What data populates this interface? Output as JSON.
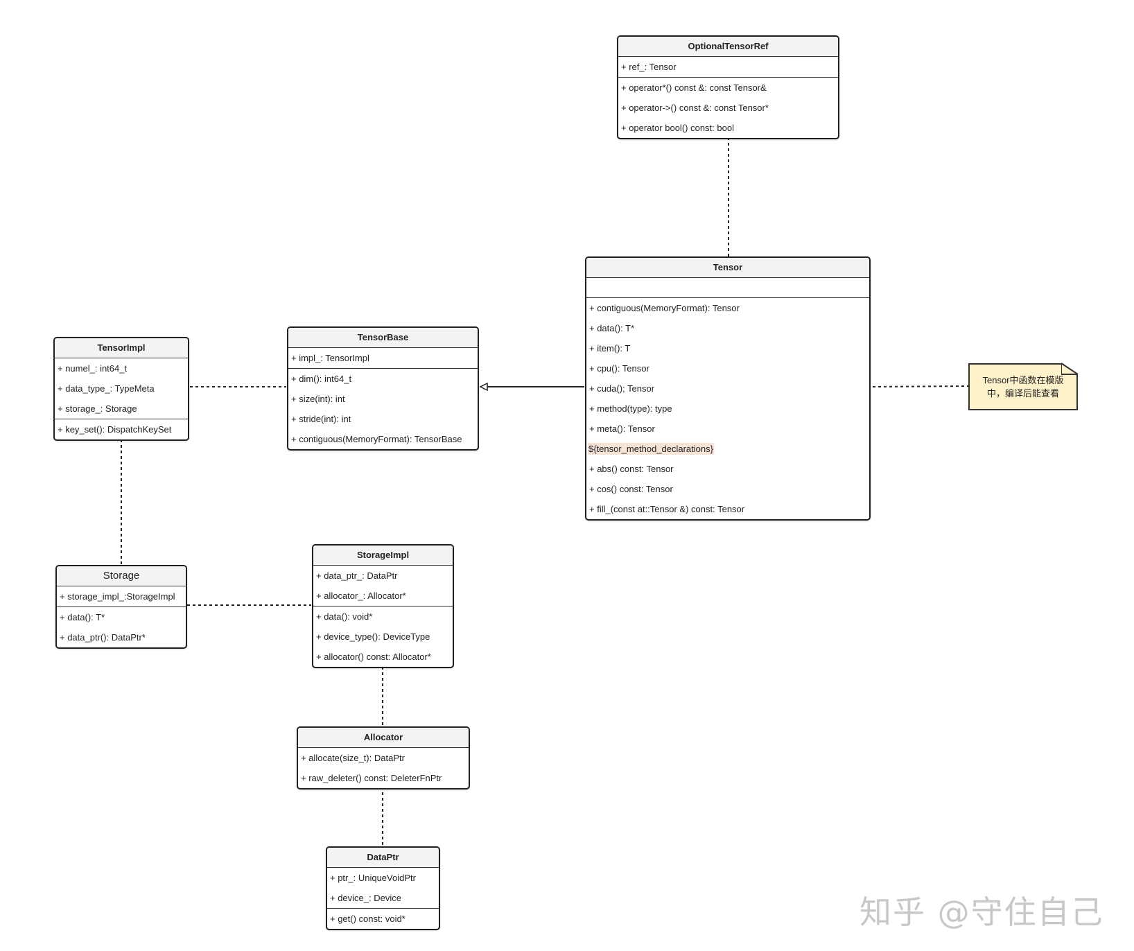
{
  "classes": {
    "optional_tensor_ref": {
      "name": "OptionalTensorRef",
      "attributes": [
        "+ ref_: Tensor"
      ],
      "methods": [
        "+ operator*() const &: const Tensor&",
        "+ operator->() const &: const Tensor*",
        "+ operator bool() const: bool"
      ]
    },
    "tensor": {
      "name": "Tensor",
      "methods_before": [
        "+ contiguous(MemoryFormat): Tensor",
        "+ data(): T*",
        "+ item(): T",
        "+ cpu(): Tensor",
        "+ cuda(); Tensor",
        "+ method(type): type",
        "+ meta(): Tensor"
      ],
      "template_placeholder": "${tensor_method_declarations}",
      "methods_after": [
        "+ abs() const: Tensor",
        "+ cos() const:  Tensor",
        "+ fill_(const at::Tensor &) const: Tensor"
      ]
    },
    "tensor_base": {
      "name": "TensorBase",
      "attributes": [
        "+ impl_: TensorImpl"
      ],
      "methods": [
        "+ dim(): int64_t",
        "+ size(int): int",
        "+ stride(int): int",
        "+ contiguous(MemoryFormat): TensorBase"
      ]
    },
    "tensor_impl": {
      "name": "TensorImpl",
      "attributes": [
        "+ numel_: int64_t",
        "+ data_type_: TypeMeta",
        "+ storage_: Storage"
      ],
      "methods": [
        "+ key_set(): DispatchKeySet"
      ]
    },
    "storage": {
      "name": "Storage",
      "attributes": [
        "+ storage_impl_:StorageImpl"
      ],
      "methods": [
        "+ data(): T*",
        "+ data_ptr(): DataPtr*"
      ]
    },
    "storage_impl": {
      "name": "StorageImpl",
      "attributes": [
        "+ data_ptr_: DataPtr",
        "+ allocator_: Allocator*"
      ],
      "methods": [
        "+ data(): void*",
        "+ device_type(): DeviceType",
        "+ allocator() const: Allocator*"
      ]
    },
    "allocator": {
      "name": "Allocator",
      "attributes": [
        "+ allocate(size_t): DataPtr",
        "+ raw_deleter() const: DeleterFnPtr"
      ]
    },
    "data_ptr": {
      "name": "DataPtr",
      "attributes": [
        "+ ptr_: UniqueVoidPtr",
        "+ device_: Device"
      ],
      "methods": [
        "+ get() const: void*"
      ]
    }
  },
  "note": {
    "line1": "Tensor中函数在模版",
    "line2": "中，编译后能查看"
  },
  "watermark": "知乎 @守住自己",
  "colors": {
    "note_fill": "#fdf2c9",
    "header_fill": "#f3f3f3",
    "highlight": "#f8e3d7",
    "border": "#1f1f1f"
  }
}
